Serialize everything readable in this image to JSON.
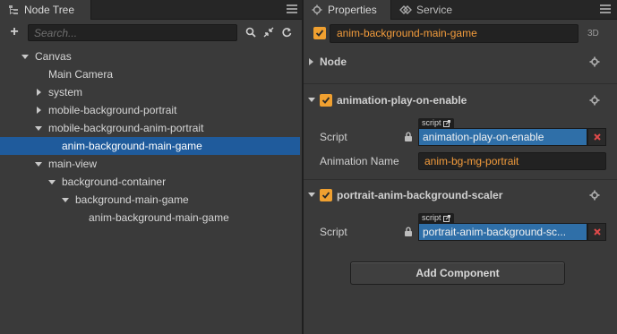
{
  "node_tree": {
    "tab_label": "Node Tree",
    "icons": {
      "tab": "node-tree-icon",
      "menu": "hamburger-menu-icon",
      "add": "plus-icon",
      "search": "search-icon",
      "collapse": "collapse-icon",
      "refresh": "refresh-icon"
    },
    "search": {
      "placeholder": "Search...",
      "value": ""
    },
    "items": [
      {
        "label": "Canvas",
        "depth": 0,
        "arrow": "down",
        "selected": false
      },
      {
        "label": "Main Camera",
        "depth": 1,
        "arrow": "none",
        "selected": false
      },
      {
        "label": "system",
        "depth": 1,
        "arrow": "right",
        "selected": false
      },
      {
        "label": "mobile-background-portrait",
        "depth": 1,
        "arrow": "right",
        "selected": false
      },
      {
        "label": "mobile-background-anim-portrait",
        "depth": 1,
        "arrow": "down",
        "selected": false
      },
      {
        "label": "anim-background-main-game",
        "depth": 2,
        "arrow": "none",
        "selected": true
      },
      {
        "label": "main-view",
        "depth": 1,
        "arrow": "down",
        "selected": false
      },
      {
        "label": "background-container",
        "depth": 2,
        "arrow": "down",
        "selected": false
      },
      {
        "label": "background-main-game",
        "depth": 3,
        "arrow": "down",
        "selected": false
      },
      {
        "label": "anim-background-main-game",
        "depth": 4,
        "arrow": "none",
        "selected": false
      }
    ]
  },
  "properties": {
    "tabs": [
      {
        "label": "Properties",
        "icon": "gear-icon",
        "active": true
      },
      {
        "label": "Service",
        "icon": "service-icon",
        "active": false
      }
    ],
    "node": {
      "enabled": true,
      "name": "anim-background-main-game",
      "mode_label": "3D"
    },
    "node_section": {
      "title": "Node",
      "collapsed": true
    },
    "components": [
      {
        "title": "animation-play-on-enable",
        "enabled": true,
        "script_tag": "script",
        "script_label": "Script",
        "script_value": "animation-play-on-enable",
        "extra_label": "Animation Name",
        "extra_value": "anim-bg-mg-portrait"
      },
      {
        "title": "portrait-anim-background-scaler",
        "enabled": true,
        "script_tag": "script",
        "script_label": "Script",
        "script_value": "portrait-anim-background-sc..."
      }
    ],
    "add_component_label": "Add Component"
  },
  "colors": {
    "selection": "#1f5b9c",
    "accent_orange": "#f39c3c",
    "checkbox": "#f0a030",
    "script_field": "#2f6fa8",
    "clear_x": "#e04a4a"
  }
}
